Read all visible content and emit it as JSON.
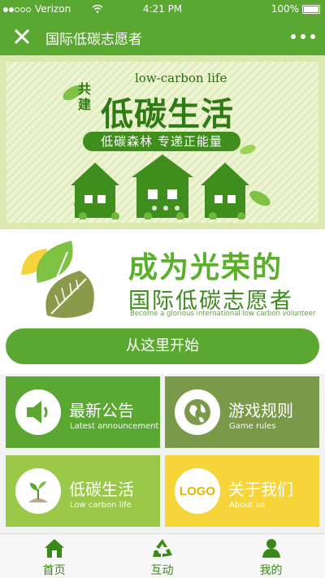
{
  "status_bar": {
    "carrier": "Verizon",
    "time": "4:21 PM",
    "battery": "100%"
  },
  "nav": {
    "title": "国际低碳志愿者"
  },
  "banner": {
    "en_title": "low-carbon life",
    "small_text": "共建",
    "main_text": "低碳生活",
    "pill_text": "低碳森林 专递正能量"
  },
  "hero": {
    "title": "成为光荣的",
    "subtitle": "国际低碳志愿者",
    "english": "Become a glorious international low carbon volunteer"
  },
  "start_button": {
    "label": "从这里开始"
  },
  "tiles": [
    {
      "title": "最新公告",
      "subtitle": "Latest announcement",
      "icon": "speaker-icon",
      "color": "#5aa832"
    },
    {
      "title": "游戏规则",
      "subtitle": "Game rules",
      "icon": "globe-icon",
      "color": "#7a9a4a"
    },
    {
      "title": "低碳生活",
      "subtitle": "Low carbon life",
      "icon": "sprout-icon",
      "color": "#9ac849"
    },
    {
      "title": "关于我们",
      "subtitle": "About us",
      "icon": "logo-icon",
      "logo_text": "LOGO",
      "color": "#f6d53a"
    }
  ],
  "tabbar": [
    {
      "label": "首页",
      "icon": "home-icon"
    },
    {
      "label": "互动",
      "icon": "recycle-icon"
    },
    {
      "label": "我的",
      "icon": "user-icon"
    }
  ],
  "colors": {
    "primary": "#5aa832",
    "dark_green": "#3a8a1a",
    "olive": "#7a9a4a",
    "lime": "#9ac849",
    "yellow": "#f6d53a"
  }
}
